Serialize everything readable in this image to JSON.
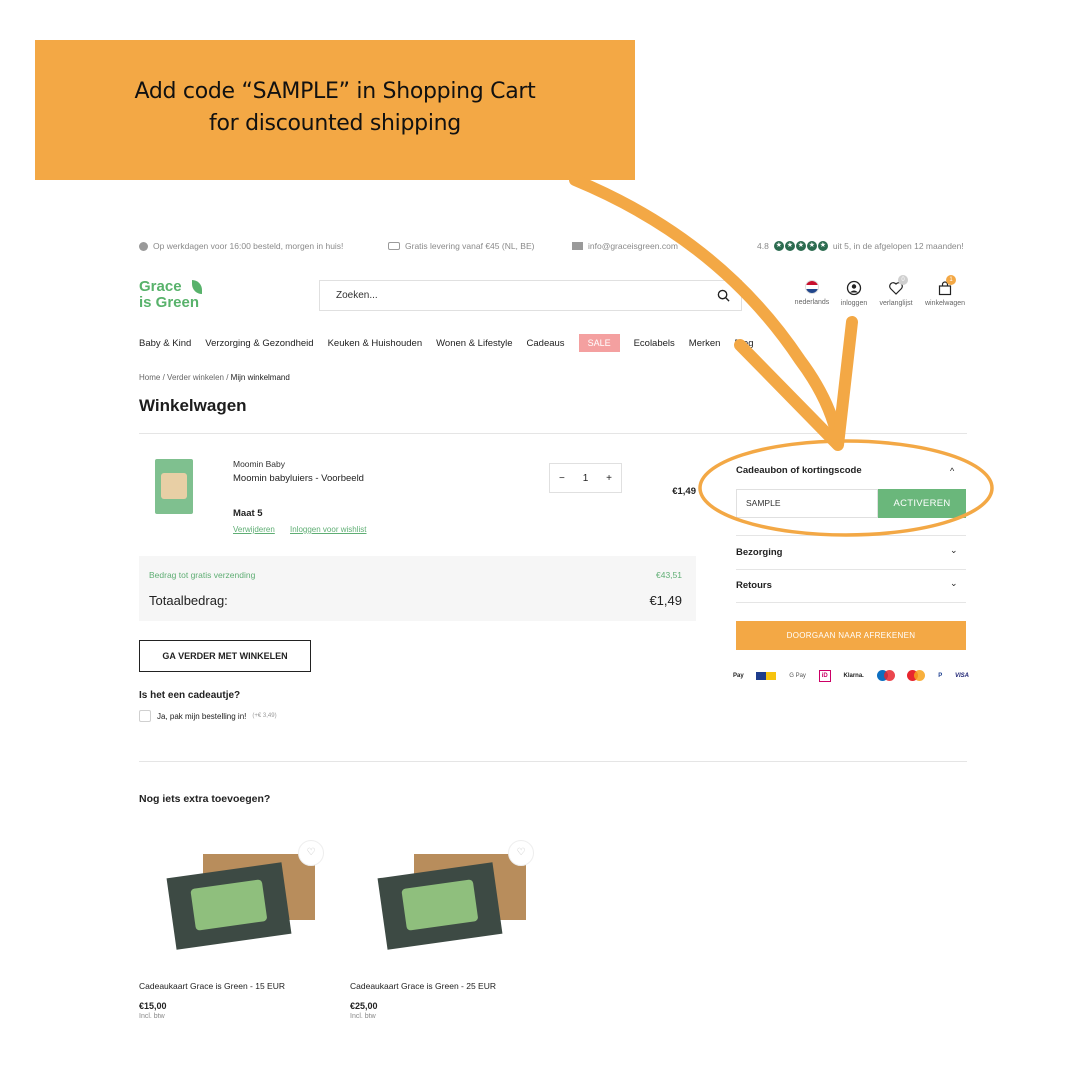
{
  "banner": {
    "line1": "Add code “SAMPLE” in Shopping Cart",
    "line2": "for discounted shipping",
    "color": "#f3a845"
  },
  "topbar": {
    "delivery": "Op werkdagen voor 16:00 besteld, morgen in huis!",
    "shipping": "Gratis levering vanaf €45 (NL, BE)",
    "email": "info@graceisgreen.com",
    "rating": "4.8",
    "rating_suffix": "uit 5, in de afgelopen 12 maanden!",
    "stars": 5
  },
  "logo": {
    "line1": "Grace",
    "line2": "is Green",
    "color": "#58b26b"
  },
  "search": {
    "placeholder": "Zoeken..."
  },
  "header_icons": {
    "language": "nederlands",
    "login": "inloggen",
    "wishlist": "verlanglijst",
    "wishlist_count": "0",
    "cart": "winkelwagen",
    "cart_count": "1"
  },
  "nav": [
    "Baby & Kind",
    "Verzorging & Gezondheid",
    "Keuken & Huishouden",
    "Wonen & Lifestyle",
    "Cadeaus",
    "SALE",
    "Ecolabels",
    "Merken",
    "Blog"
  ],
  "breadcrumb": {
    "home": "Home",
    "sep": "/",
    "level2": "Verder winkelen",
    "current": "Mijn winkelmand"
  },
  "page_title": "Winkelwagen",
  "cart_item": {
    "brand": "Moomin Baby",
    "name": "Moomin babyluiers - Voorbeeld",
    "size": "Maat 5",
    "remove": "Verwijderen",
    "wishlist_login": "Inloggen voor wishlist",
    "qty": "1",
    "minus": "−",
    "plus": "+",
    "price": "€1,49"
  },
  "totals": {
    "free_shipping_label": "Bedrag tot gratis verzending",
    "free_shipping_value": "€43,51",
    "total_label": "Totaalbedrag:",
    "total_value": "€1,49"
  },
  "continue_label": "GA VERDER MET WINKELEN",
  "gift": {
    "question": "Is het een cadeautje?",
    "option": "Ja, pak mijn bestelling in!",
    "option_price": "(+€ 3,49)"
  },
  "sidebar": {
    "coupon_title": "Cadeaubon of kortingscode",
    "coupon_value": "SAMPLE",
    "coupon_button": "ACTIVEREN",
    "delivery_title": "Bezorging",
    "returns_title": "Retours",
    "checkout_label": "DOORGAAN NAAR AFREKENEN",
    "chevron_up": "^",
    "chevron_down": "⌄"
  },
  "payment": {
    "applepay": "Pay",
    "gpay": "G Pay",
    "ideal": "iD",
    "klarna": "Klarna.",
    "paypal": "P",
    "visa": "VISA"
  },
  "extra": {
    "title": "Nog iets extra toevoegen?",
    "products": [
      {
        "name": "Cadeaukaart Grace is Green - 15 EUR",
        "price": "€15,00",
        "vat": "Incl. btw"
      },
      {
        "name": "Cadeaukaart Grace is Green - 25 EUR",
        "price": "€25,00",
        "vat": "Incl. btw"
      }
    ]
  },
  "colors": {
    "accent_orange": "#f3a845",
    "brand_green": "#58b26b",
    "button_green": "#6ab77b",
    "sale_pink": "#f4a0a0"
  }
}
